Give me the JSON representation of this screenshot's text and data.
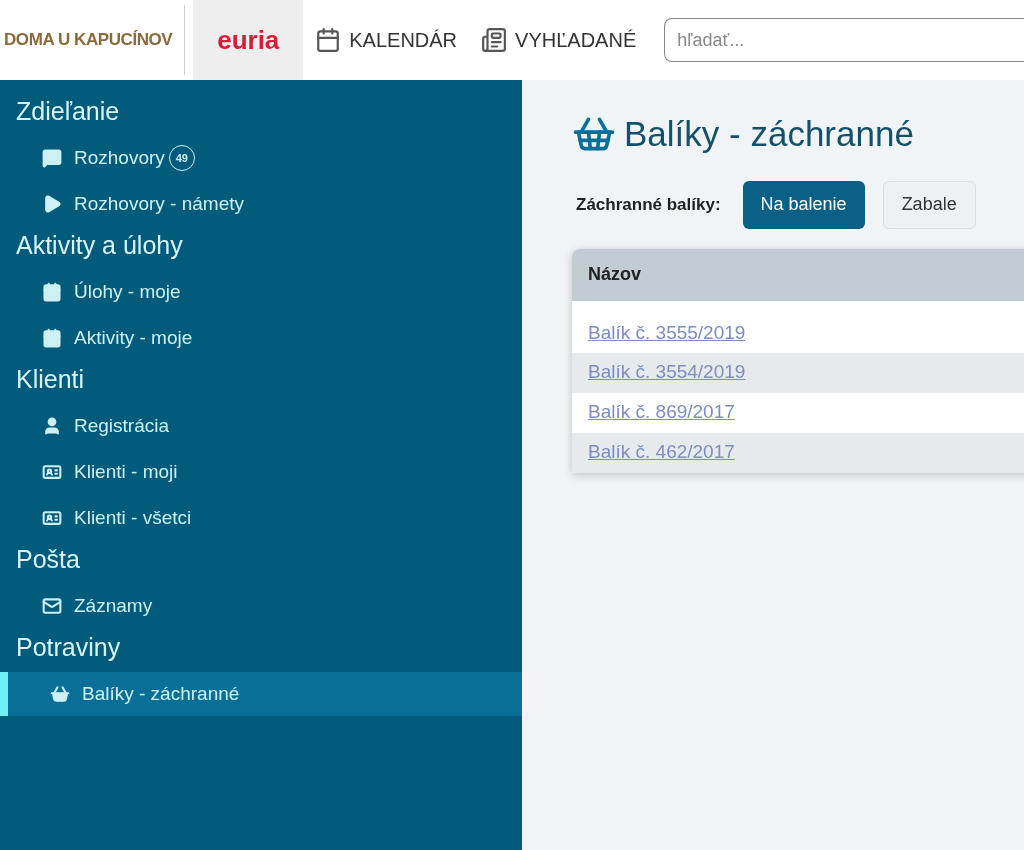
{
  "header": {
    "brand": "DOMA U KAPUCÍNOV",
    "logo": "euria",
    "nav": [
      {
        "label": "KALENDÁR",
        "selected": false
      },
      {
        "label": "VYHĽADANÉ",
        "selected": false
      }
    ],
    "search": {
      "placeholder": "hľadať..."
    }
  },
  "sidebar": {
    "sections": [
      {
        "title": "Zdieľanie",
        "items": [
          {
            "label": "Rozhovory",
            "badge": "49",
            "selected": false
          },
          {
            "label": "Rozhovory - námety",
            "selected": false
          }
        ]
      },
      {
        "title": "Aktivity a úlohy",
        "items": [
          {
            "label": "Úlohy - moje",
            "selected": false
          },
          {
            "label": "Aktivity - moje",
            "selected": false
          }
        ]
      },
      {
        "title": "Klienti",
        "items": [
          {
            "label": "Registrácia",
            "selected": false
          },
          {
            "label": "Klienti - moji",
            "selected": false
          },
          {
            "label": "Klienti - všetci",
            "selected": false
          }
        ]
      },
      {
        "title": "Pošta",
        "items": [
          {
            "label": "Záznamy",
            "selected": false
          }
        ]
      },
      {
        "title": "Potraviny",
        "items": [
          {
            "label": "Balíky - záchranné",
            "selected": true
          }
        ]
      }
    ]
  },
  "main": {
    "title": "Balíky - záchranné",
    "filter_label": "Záchranné balíky:",
    "filters": [
      {
        "label": "Na balenie",
        "selected": true
      },
      {
        "label": "Zabale",
        "selected": false
      }
    ],
    "table": {
      "columns": [
        "Názov"
      ],
      "rows": [
        "Balík č. 3555/2019",
        "Balík č. 3554/2019",
        "Balík č. 869/2017",
        "Balík č. 462/2017"
      ]
    }
  }
}
